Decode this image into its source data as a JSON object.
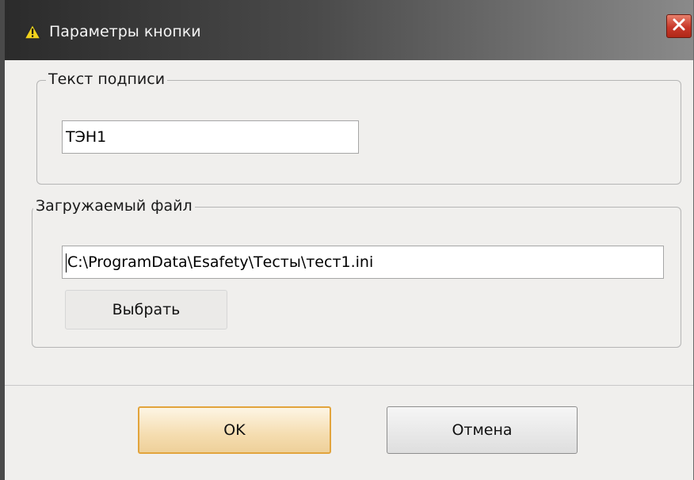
{
  "window": {
    "title": "Параметры кнопки",
    "icon": "warning-icon",
    "close_icon": "close-icon"
  },
  "caption_group": {
    "legend": "Текст подписи",
    "caption_value": "ТЭН1"
  },
  "file_group": {
    "legend": "Загружаемый файл",
    "path_value": "C:\\ProgramData\\Esafety\\Тесты\\тест1.ini",
    "browse_label": "Выбрать"
  },
  "footer": {
    "ok_label": "OK",
    "cancel_label": "Отмена"
  },
  "colors": {
    "titlebar_dark": "#2b2b2b",
    "close_red": "#c8382a",
    "default_button_border": "#e2a43c",
    "dialog_bg": "#f0efed"
  }
}
